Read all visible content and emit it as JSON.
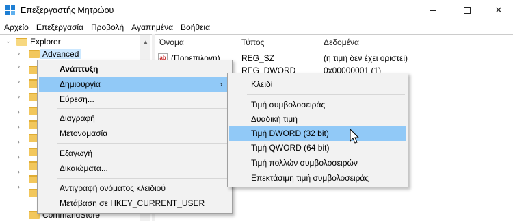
{
  "window": {
    "title": "Επεξεργαστής Μητρώου",
    "controls": {
      "minimize": "minimize-icon",
      "maximize": "maximize-icon",
      "close": "✕"
    }
  },
  "menubar": [
    "Αρχείο",
    "Επεξεργασία",
    "Προβολή",
    "Αγαπημένα",
    "Βοήθεια"
  ],
  "tree": {
    "root": "Explorer",
    "selected": "Advanced",
    "last_visible": "CommandStore"
  },
  "list": {
    "columns": [
      "Όνομα",
      "Τύπος",
      "Δεδομένα"
    ],
    "rows": [
      {
        "name": "(Προεπιλογή)",
        "type": "REG_SZ",
        "data": "(η τιμή δεν έχει οριστεί)"
      },
      {
        "name": "",
        "type": "REG_DWORD",
        "data": "0x00000001 (1)"
      }
    ]
  },
  "context_menu": {
    "items": [
      {
        "label": "Ανάπτυξη",
        "bold": true
      },
      {
        "label": "Δημιουργία",
        "highlighted": true,
        "has_submenu": true
      },
      {
        "label": "Εύρεση..."
      },
      {
        "label": "Διαγραφή"
      },
      {
        "label": "Μετονομασία"
      },
      {
        "label": "Εξαγωγή"
      },
      {
        "label": "Δικαιώματα..."
      },
      {
        "label": "Αντιγραφή ονόματος κλειδιού"
      },
      {
        "label": "Μετάβαση σε HKEY_CURRENT_USER"
      }
    ]
  },
  "submenu": {
    "items": [
      {
        "label": "Κλειδί"
      },
      {
        "label": "Τιμή συμβολοσειράς"
      },
      {
        "label": "Δυαδική τιμή"
      },
      {
        "label": "Τιμή DWORD (32 bit)",
        "highlighted": true
      },
      {
        "label": "Τιμή QWORD (64 bit)"
      },
      {
        "label": "Τιμή πολλών συμβολοσειρών"
      },
      {
        "label": "Επεκτάσιμη τιμή συμβολοσειράς"
      }
    ]
  },
  "colors": {
    "highlight": "#91c9f7",
    "selection": "#cce8ff",
    "menu_bg": "#f2f2f2",
    "folder": "#f2c75c"
  }
}
